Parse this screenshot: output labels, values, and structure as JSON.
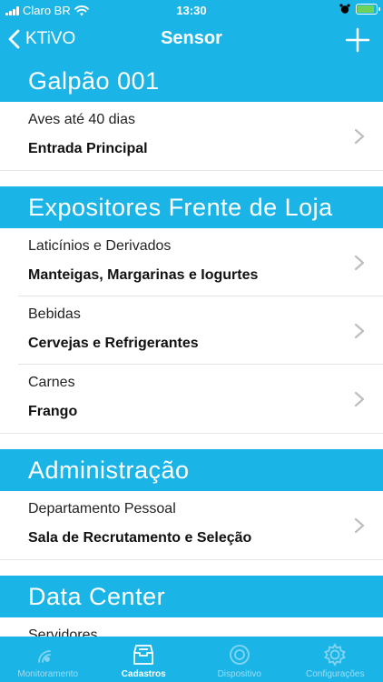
{
  "status_bar": {
    "carrier": "Claro BR",
    "time": "13:30"
  },
  "nav": {
    "back_label": "KTiVO",
    "title": "Sensor"
  },
  "sections": [
    {
      "title": "Galpão  001",
      "rows": [
        {
          "subtitle": "Aves até 40 dias",
          "title": "Entrada Principal"
        }
      ]
    },
    {
      "title": "Expositores Frente de Loja",
      "rows": [
        {
          "subtitle": "Laticínios e Derivados",
          "title": "Manteigas, Margarinas e Iogurtes"
        },
        {
          "subtitle": "Bebidas",
          "title": "Cervejas e Refrigerantes"
        },
        {
          "subtitle": "Carnes",
          "title": "Frango"
        }
      ]
    },
    {
      "title": "Administração",
      "rows": [
        {
          "subtitle": "Departamento Pessoal",
          "title": "Sala de Recrutamento e Seleção"
        }
      ]
    },
    {
      "title": "Data Center",
      "rows": [
        {
          "subtitle": "Servidores",
          "title": ""
        }
      ]
    }
  ],
  "tabs": [
    {
      "label": "Monitoramento",
      "icon": "pulse-icon",
      "active": false
    },
    {
      "label": "Cadastros",
      "icon": "inbox-icon",
      "active": true
    },
    {
      "label": "Dispositivo",
      "icon": "device-icon",
      "active": false
    },
    {
      "label": "Configurações",
      "icon": "gear-icon",
      "active": false
    }
  ],
  "colors": {
    "accent": "#1bb4e6",
    "text": "#111111",
    "battery": "#6dd35a"
  }
}
